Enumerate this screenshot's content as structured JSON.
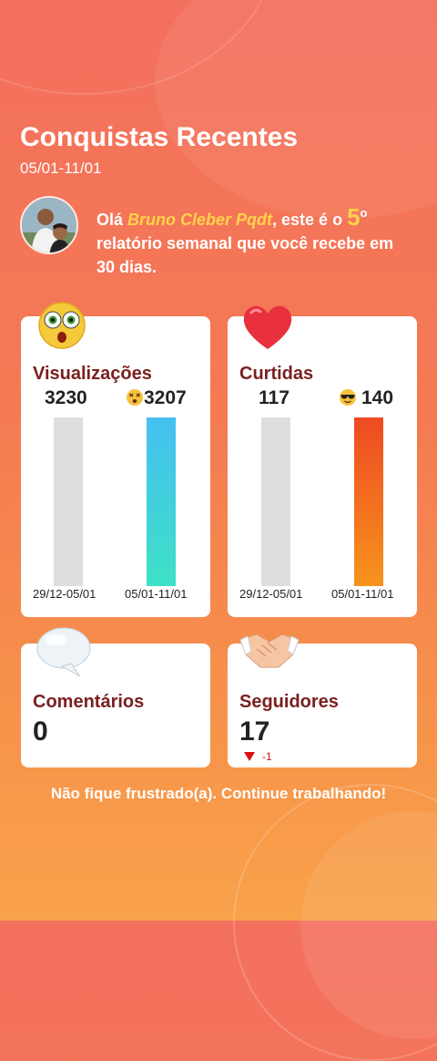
{
  "header": {
    "title": "Conquistas Recentes",
    "date_range": "05/01-11/01"
  },
  "greeting": {
    "prefix": "Olá ",
    "user_name": "Bruno Cleber Pqdt",
    "middle": ", este é o ",
    "report_number": "5",
    "ordinal": "o",
    "suffix": " relatório semanal que você recebe em 30 dias."
  },
  "cards": {
    "views": {
      "title": "Visualizações",
      "previous_value": "3230",
      "current_value": "3207",
      "previous_period": "29/12-05/01",
      "current_period": "05/01-11/01",
      "sticker_icon": "shocked-face-icon",
      "value_icon": "dizzy-face-icon"
    },
    "likes": {
      "title": "Curtidas",
      "previous_value": "117",
      "current_value": "140",
      "previous_period": "29/12-05/01",
      "current_period": "05/01-11/01",
      "sticker_icon": "heart-icon",
      "value_icon": "sunglasses-face-icon"
    },
    "comments": {
      "title": "Comentários",
      "value": "0",
      "sticker_icon": "speech-bubble-icon"
    },
    "followers": {
      "title": "Seguidores",
      "value": "17",
      "change": "-1",
      "change_icon": "down-triangle-icon",
      "sticker_icon": "handshake-icon"
    }
  },
  "footer": {
    "message": "Não fique frustrado(a). Continue trabalhando!"
  },
  "colors": {
    "accent_name": "#ffd24a",
    "card_title": "#7a1f1f",
    "views_bar": "#45c0f1",
    "likes_bar": "#ee4a22",
    "decrease": "#dd1111"
  }
}
